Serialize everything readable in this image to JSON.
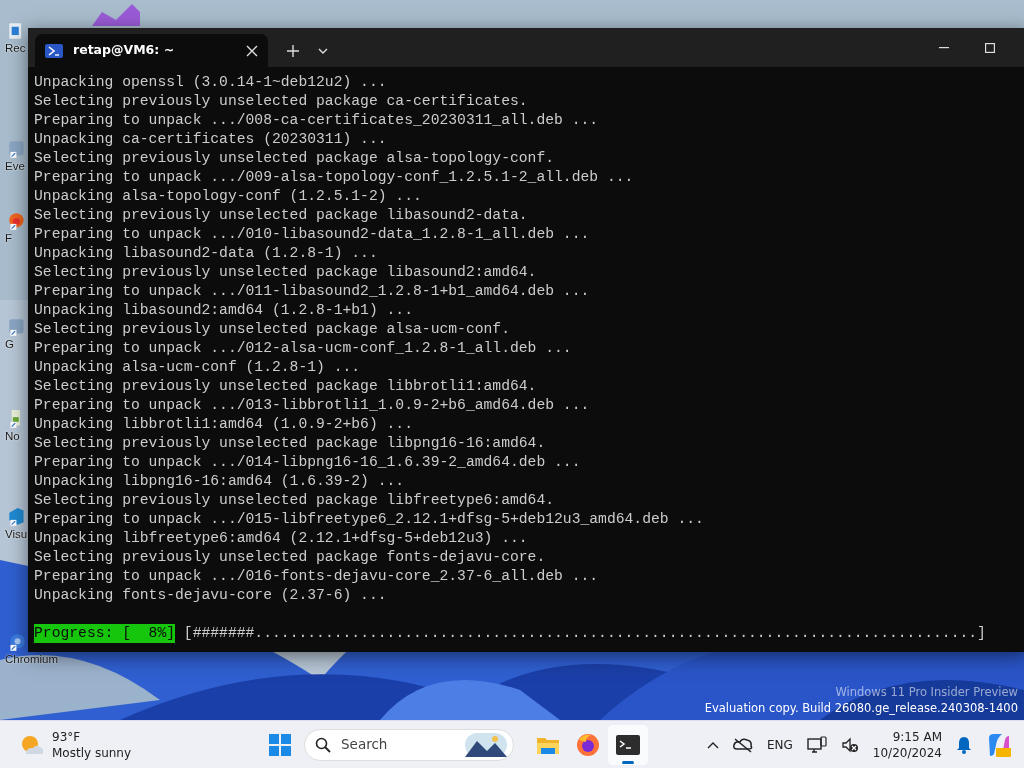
{
  "desktop": {
    "icons": [
      {
        "label": "Rec",
        "kind": "bin"
      },
      {
        "label": "Eve",
        "kind": "app"
      },
      {
        "label": "F",
        "kind": "firefox"
      },
      {
        "label": "G",
        "kind": "app"
      },
      {
        "label": "No",
        "kind": "notepad"
      },
      {
        "label": "Visu",
        "kind": "vscode"
      },
      {
        "label": "Chromium",
        "kind": "chromium"
      }
    ],
    "watermark": [
      "Windows 11 Pro Insider Preview",
      "Evaluation copy. Build 26080.ge_release.240308-1400"
    ]
  },
  "window": {
    "tabs": [
      {
        "title": "retap@VM6: ~",
        "selected": true
      }
    ],
    "lines": [
      "Unpacking openssl (3.0.14-1~deb12u2) ...",
      "Selecting previously unselected package ca-certificates.",
      "Preparing to unpack .../008-ca-certificates_20230311_all.deb ...",
      "Unpacking ca-certificates (20230311) ...",
      "Selecting previously unselected package alsa-topology-conf.",
      "Preparing to unpack .../009-alsa-topology-conf_1.2.5.1-2_all.deb ...",
      "Unpacking alsa-topology-conf (1.2.5.1-2) ...",
      "Selecting previously unselected package libasound2-data.",
      "Preparing to unpack .../010-libasound2-data_1.2.8-1_all.deb ...",
      "Unpacking libasound2-data (1.2.8-1) ...",
      "Selecting previously unselected package libasound2:amd64.",
      "Preparing to unpack .../011-libasound2_1.2.8-1+b1_amd64.deb ...",
      "Unpacking libasound2:amd64 (1.2.8-1+b1) ...",
      "Selecting previously unselected package alsa-ucm-conf.",
      "Preparing to unpack .../012-alsa-ucm-conf_1.2.8-1_all.deb ...",
      "Unpacking alsa-ucm-conf (1.2.8-1) ...",
      "Selecting previously unselected package libbrotli1:amd64.",
      "Preparing to unpack .../013-libbrotli1_1.0.9-2+b6_amd64.deb ...",
      "Unpacking libbrotli1:amd64 (1.0.9-2+b6) ...",
      "Selecting previously unselected package libpng16-16:amd64.",
      "Preparing to unpack .../014-libpng16-16_1.6.39-2_amd64.deb ...",
      "Unpacking libpng16-16:amd64 (1.6.39-2) ...",
      "Selecting previously unselected package libfreetype6:amd64.",
      "Preparing to unpack .../015-libfreetype6_2.12.1+dfsg-5+deb12u3_amd64.deb ...",
      "Unpacking libfreetype6:amd64 (2.12.1+dfsg-5+deb12u3) ...",
      "Selecting previously unselected package fonts-dejavu-core.",
      "Preparing to unpack .../016-fonts-dejavu-core_2.37-6_all.deb ...",
      "Unpacking fonts-dejavu-core (2.37-6) ..."
    ],
    "progress": {
      "label": "Progress: [  8%]",
      "bar": "[#######..................................................................................]"
    }
  },
  "taskbar": {
    "weather": {
      "temperature": "93°F",
      "condition": "Mostly sunny"
    },
    "search": {
      "placeholder": "Search"
    },
    "apps": [
      {
        "kind": "start",
        "selected": false
      },
      {
        "kind": "files",
        "selected": false
      },
      {
        "kind": "firefox",
        "selected": false
      },
      {
        "kind": "terminal",
        "selected": true
      }
    ],
    "language": "ENG",
    "time": "9:15 AM",
    "date": "10/20/2024"
  }
}
